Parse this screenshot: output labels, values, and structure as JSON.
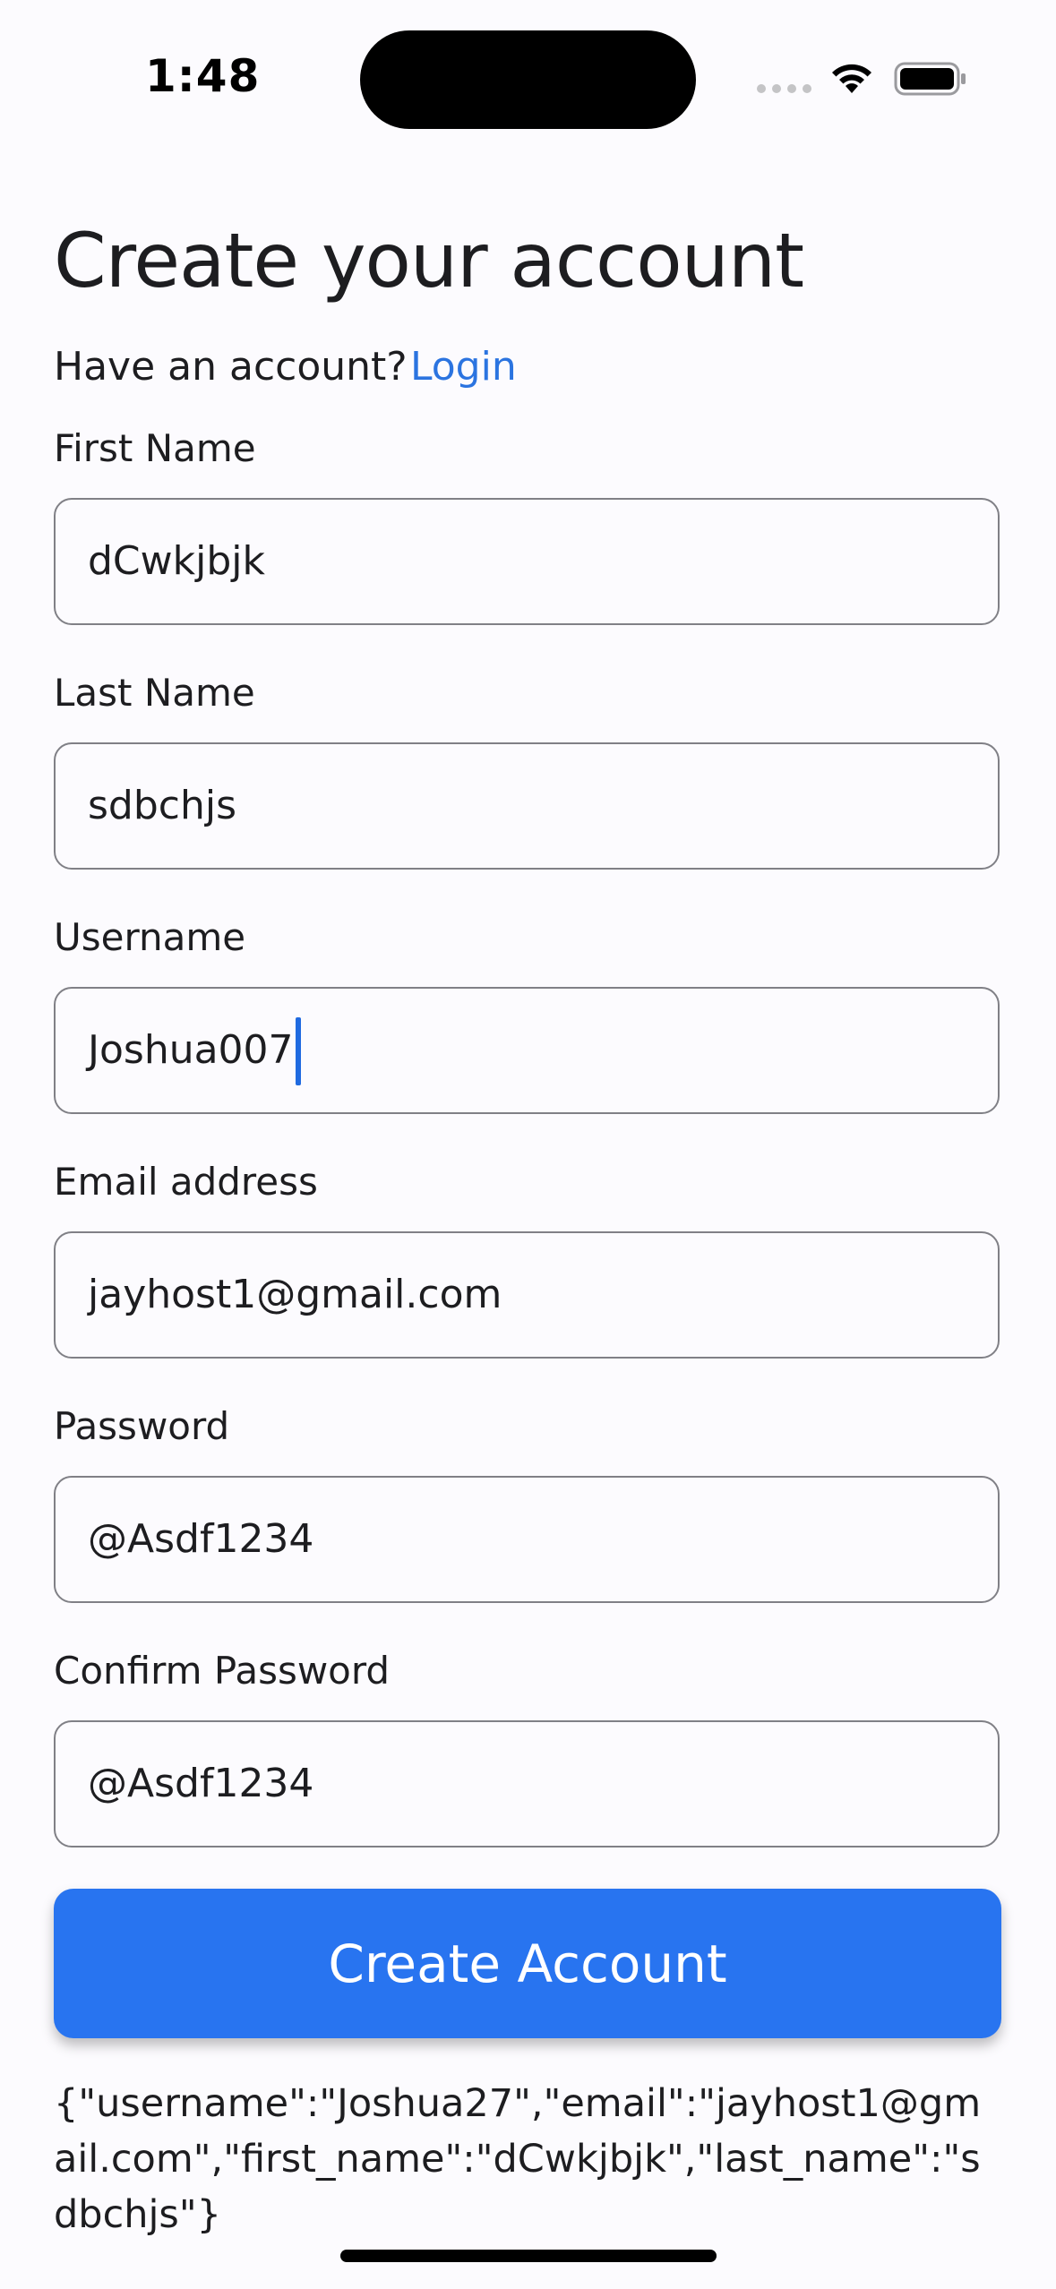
{
  "status_bar": {
    "time": "1:48",
    "icons": [
      "signal-icon",
      "wifi-icon",
      "battery-icon"
    ]
  },
  "title": "Create your account",
  "login_prompt": {
    "text": "Have an account?",
    "link_label": "Login"
  },
  "form": {
    "first_name": {
      "label": "First Name",
      "value": "dCwkjbjk"
    },
    "last_name": {
      "label": "Last Name",
      "value": "sdbchjs"
    },
    "username": {
      "label": "Username",
      "value": "Joshua007",
      "focused": true
    },
    "email": {
      "label": "Email address",
      "value": "jayhost1@gmail.com"
    },
    "password": {
      "label": "Password",
      "value": "@Asdf1234"
    },
    "confirm_password": {
      "label": "Confirm Password",
      "value": "@Asdf1234"
    }
  },
  "submit_label": "Create Account",
  "response_text": "{\"username\":\"Joshua27\",\"email\":\"jayhost1@gmail.com\",\"first_name\":\"dCwkjbjk\",\"last_name\":\"sdbchjs\"}",
  "colors": {
    "accent": "#2874f0",
    "link": "#2b74e0",
    "background": "#fcfbfe",
    "input_border": "#808086"
  }
}
